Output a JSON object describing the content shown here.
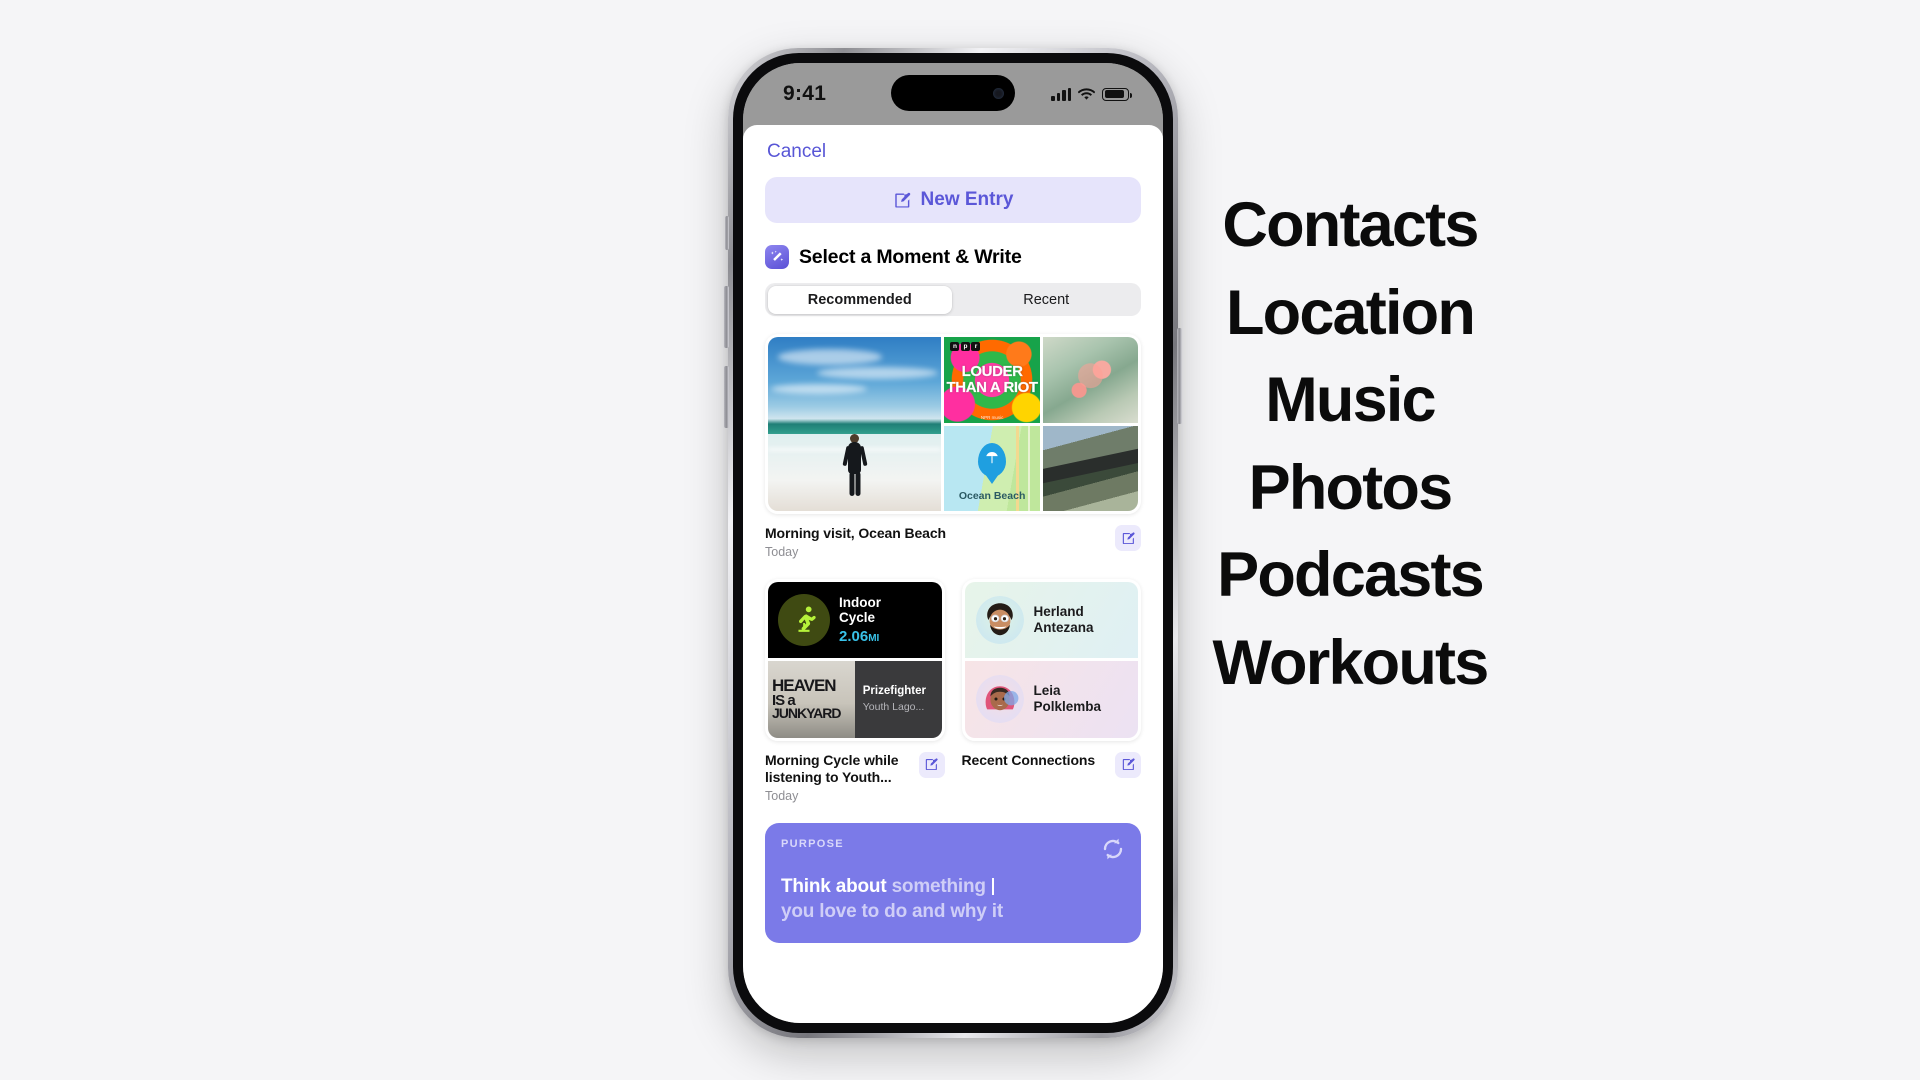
{
  "status_bar": {
    "time": "9:41",
    "signal_icon": "cellular-bars-icon",
    "wifi_icon": "wifi-icon",
    "battery_icon": "battery-icon"
  },
  "sheet": {
    "cancel_label": "Cancel",
    "new_entry_label": "New Entry",
    "new_entry_icon": "compose-icon",
    "section_title": "Select a Moment & Write",
    "section_icon": "magic-wand-icon",
    "segments": [
      {
        "label": "Recommended",
        "active": true
      },
      {
        "label": "Recent",
        "active": false
      }
    ]
  },
  "suggestions": [
    {
      "id": "ocean-beach",
      "title": "Morning visit, Ocean Beach",
      "subtitle": "Today",
      "edit_icon": "compose-icon",
      "tiles": {
        "photo_alt": "surfer-walking-on-beach-photo",
        "podcast": {
          "network": "NPR",
          "title_lines": [
            "LOUDER",
            "THAN",
            "A RIOT"
          ],
          "footer": "NPR music"
        },
        "shell_alt": "shell-on-sand-photo",
        "map": {
          "place": "Ocean Beach",
          "pin_icon": "beach-umbrella-icon"
        },
        "cliff_alt": "coastal-road-photo"
      }
    },
    {
      "id": "morning-cycle",
      "title": "Morning Cycle while listening to Youth...",
      "subtitle": "Today",
      "edit_icon": "compose-icon",
      "workout": {
        "name_lines": [
          "Indoor",
          "Cycle"
        ],
        "distance": "2.06",
        "unit": "MI",
        "icon": "indoor-cycle-icon"
      },
      "music": {
        "album_lines": [
          "HEAVEN",
          "IS a",
          "JUNKYARD"
        ],
        "track": "Prizefighter",
        "artist": "Youth Lago..."
      }
    },
    {
      "id": "recent-connections",
      "title": "Recent Connections",
      "edit_icon": "compose-icon",
      "contacts": [
        {
          "first": "Herland",
          "last": "Antezana",
          "avatar": "memoji-avatar"
        },
        {
          "first": "Leia",
          "last": "Polklemba",
          "avatar": "memoji-avatar"
        }
      ]
    }
  ],
  "purpose_card": {
    "label": "PURPOSE",
    "refresh_icon": "refresh-icon",
    "text_line1_strong": "Think about",
    "text_line1_dim": "something",
    "text_line2_dim": "you love to do and why it",
    "accent": "#7b7ae8"
  },
  "right_list": {
    "items": [
      "Contacts",
      "Location",
      "Music",
      "Photos",
      "Podcasts",
      "Workouts"
    ]
  }
}
